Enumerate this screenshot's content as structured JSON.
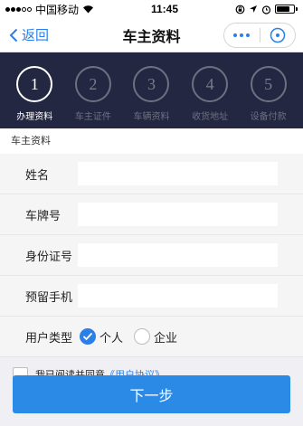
{
  "status_bar": {
    "carrier": "中国移动",
    "time": "11:45"
  },
  "nav": {
    "back_label": "返回",
    "title": "车主资料"
  },
  "steps": [
    {
      "num": "1",
      "label": "办理资料",
      "active": true
    },
    {
      "num": "2",
      "label": "车主证件",
      "active": false
    },
    {
      "num": "3",
      "label": "车辆资料",
      "active": false
    },
    {
      "num": "4",
      "label": "收货地址",
      "active": false
    },
    {
      "num": "5",
      "label": "设备付款",
      "active": false
    }
  ],
  "section_title": "车主资料",
  "fields": {
    "name_label": "姓名",
    "plate_label": "车牌号",
    "id_label": "身份证号",
    "phone_label": "预留手机",
    "user_type_label": "用户类型"
  },
  "user_type": {
    "options": [
      "个人",
      "企业"
    ],
    "selected": "个人"
  },
  "agreement": {
    "text": "我已阅读并同意",
    "link": "《用户协议》"
  },
  "next_button": "下一步",
  "colors": {
    "accent": "#2b7fe8",
    "steps_bg": "#232742",
    "button": "#2b8ae6"
  }
}
